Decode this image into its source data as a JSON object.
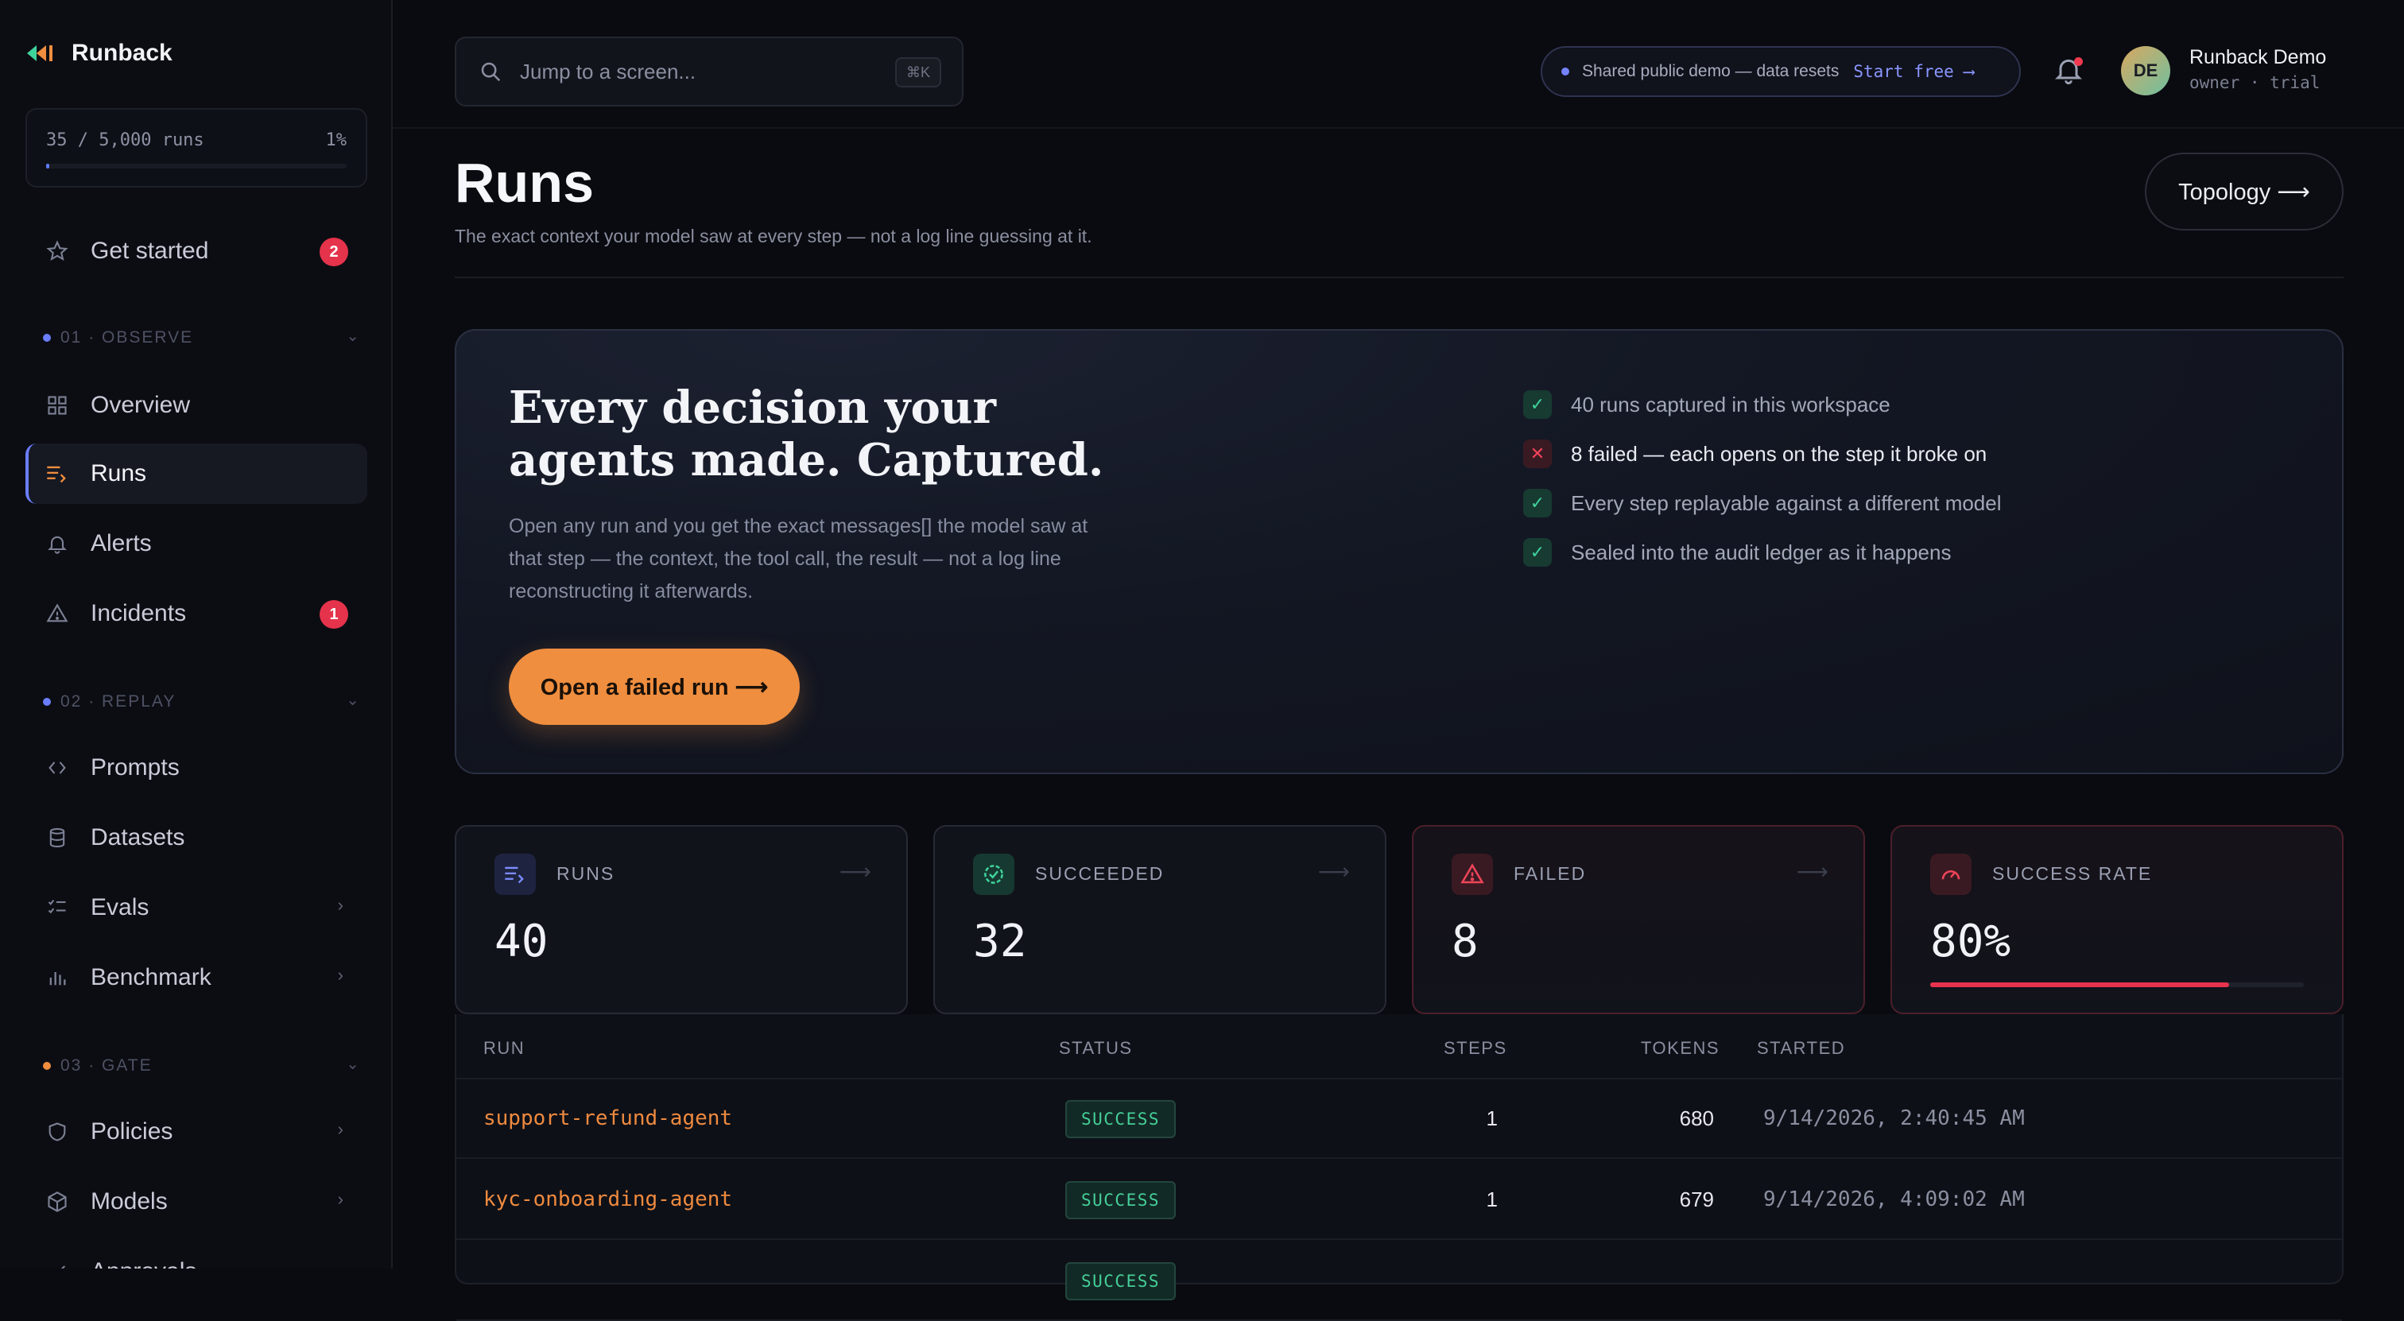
{
  "brand": {
    "name": "Runback"
  },
  "usage": {
    "text": "35 / 5,000 runs",
    "percent_label": "1%",
    "fraction": 0.01
  },
  "sidebar": {
    "get_started": {
      "label": "Get started",
      "badge": "2"
    },
    "sections": [
      {
        "label": "01 · OBSERVE",
        "dot_color": "#6b7dff"
      },
      {
        "label": "02 · REPLAY",
        "dot_color": "#6b7dff"
      },
      {
        "label": "03 · GATE",
        "dot_color": "#ef8e3f"
      }
    ],
    "observe": [
      {
        "label": "Overview"
      },
      {
        "label": "Runs"
      },
      {
        "label": "Alerts"
      },
      {
        "label": "Incidents",
        "badge": "1"
      }
    ],
    "replay": [
      {
        "label": "Prompts"
      },
      {
        "label": "Datasets"
      },
      {
        "label": "Evals"
      },
      {
        "label": "Benchmark"
      }
    ],
    "gate": [
      {
        "label": "Policies"
      },
      {
        "label": "Models"
      },
      {
        "label": "Approvals"
      }
    ]
  },
  "search": {
    "placeholder": "Jump to a screen...",
    "shortcut": "⌘K"
  },
  "demo_banner": {
    "message": "Shared public demo — data resets",
    "cta": "Start free ⟶"
  },
  "user": {
    "initials": "DE",
    "name": "Runback Demo",
    "role": "owner · trial"
  },
  "page": {
    "title": "Runs",
    "subtitle": "The exact context your model saw at every step — not a log line guessing at it.",
    "topology_button": "Topology ⟶"
  },
  "hero": {
    "title_line1": "Every decision your",
    "title_line2": "agents made. Captured.",
    "body": "Open any run and you get the exact messages[] the model saw at that step — the context, the tool call, the result — not a log line reconstructing it afterwards.",
    "cta": "Open a failed run ⟶",
    "checks": [
      {
        "text": "40 runs captured in this workspace",
        "ok": true
      },
      {
        "text": "8 failed — each opens on the step it broke on",
        "ok": false
      },
      {
        "text": "Every step replayable against a different model",
        "ok": true
      },
      {
        "text": "Sealed into the audit ledger as it happens",
        "ok": true
      }
    ]
  },
  "stats": [
    {
      "label": "RUNS",
      "value": "40"
    },
    {
      "label": "SUCCEEDED",
      "value": "32"
    },
    {
      "label": "FAILED",
      "value": "8"
    },
    {
      "label": "SUCCESS RATE",
      "value": "80%",
      "fraction": 0.8
    }
  ],
  "table": {
    "headers": {
      "run": "RUN",
      "status": "STATUS",
      "steps": "STEPS",
      "tokens": "TOKENS",
      "started": "STARTED"
    },
    "rows": [
      {
        "run": "support-refund-agent",
        "status": "SUCCESS",
        "steps": "1",
        "tokens": "680",
        "started": "9/14/2026, 2:40:45 AM"
      },
      {
        "run": "kyc-onboarding-agent",
        "status": "SUCCESS",
        "steps": "1",
        "tokens": "679",
        "started": "9/14/2026, 4:09:02 AM"
      },
      {
        "run": "",
        "status": "SUCCESS",
        "steps": "",
        "tokens": "",
        "started": ""
      }
    ]
  },
  "colors": {
    "accent": "#6b7dff",
    "cta": "#ef8e3f",
    "danger": "#e5334b",
    "success": "#45cf99",
    "run_link": "#ee8a3f"
  }
}
